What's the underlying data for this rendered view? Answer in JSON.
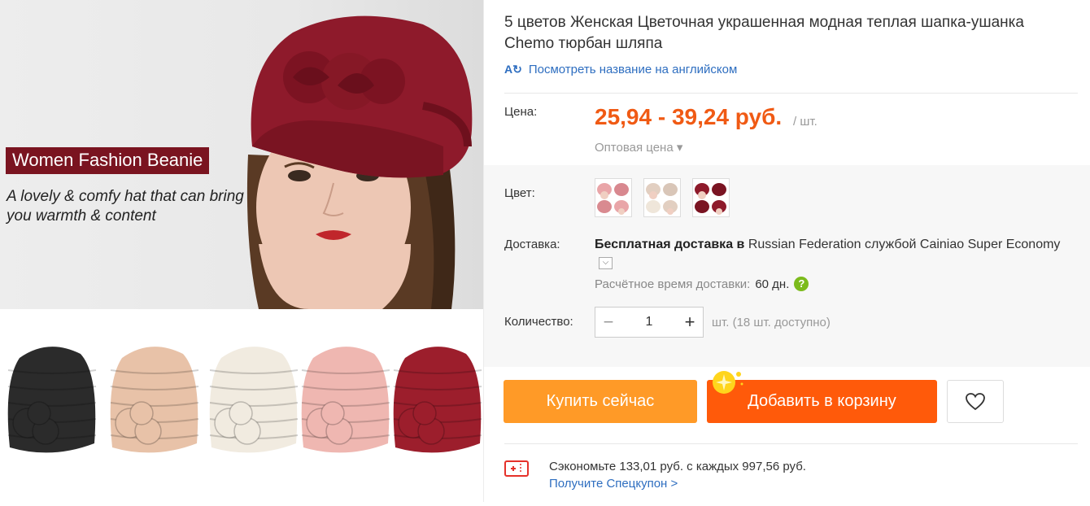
{
  "gallery": {
    "hero_badge": "Women Fashion Beanie",
    "hero_tagline": "A lovely & comfy hat that can bring you warmth & content",
    "hero_hat_color": "#8e1a2b",
    "thumbnails": [
      {
        "name": "black",
        "color": "#2b2b2b"
      },
      {
        "name": "beige",
        "color": "#e8c2a8"
      },
      {
        "name": "white",
        "color": "#f1ebe0"
      },
      {
        "name": "pink",
        "color": "#efb7b1"
      },
      {
        "name": "burgundy",
        "color": "#9c1e2c"
      }
    ]
  },
  "product": {
    "title": "5 цветов Женская Цветочная украшенная модная теплая шапка-ушанка Chemo тюрбан шляпа",
    "translate_link": "Посмотреть название на английском"
  },
  "price": {
    "label": "Цена:",
    "value": "25,94 - 39,24 руб.",
    "unit": "/ шт.",
    "wholesale": "Оптовая цена ▾",
    "color": "#f05a14"
  },
  "color": {
    "label": "Цвет:",
    "swatches": [
      {
        "name": "pink",
        "color": "#e9a5a8"
      },
      {
        "name": "beige",
        "color": "#e2cfc1"
      },
      {
        "name": "burgundy",
        "color": "#8e1a2b"
      }
    ]
  },
  "shipping": {
    "label": "Доставка:",
    "free_text": "Бесплатная доставка в",
    "country": "Russian Federation",
    "by_text": "службой",
    "service": "Cainiao Super Economy",
    "time_label": "Расчётное время доставки:",
    "time_value": "60 дн.",
    "help_icon": "?"
  },
  "quantity": {
    "label": "Количество:",
    "value": "1",
    "minus": "−",
    "plus": "+",
    "stock": "шт. (18 шт. доступно)"
  },
  "actions": {
    "buy_now": "Купить сейчас",
    "add_to_cart": "Добавить в корзину",
    "buy_color": "#ff9a27",
    "cart_color": "#ff5a0a"
  },
  "coupon": {
    "save_text": "Сэкономьте 133,01 руб. с каждых 997,56 руб.",
    "link": "Получите Спецкупон >"
  }
}
